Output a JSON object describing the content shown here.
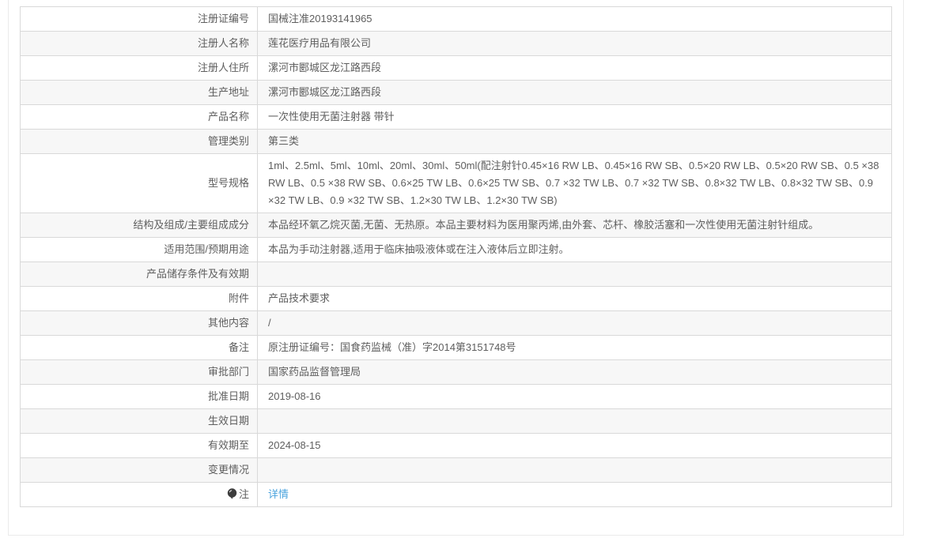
{
  "colors": {
    "link": "#4ba4de",
    "text": "#5e5e5e",
    "row_alt_bg": "#f7f7f7",
    "border": "#d9d9d9"
  },
  "table": {
    "rows": [
      {
        "label": "注册证编号",
        "value": "国械注准20193141965"
      },
      {
        "label": "注册人名称",
        "value": "莲花医疗用品有限公司"
      },
      {
        "label": "注册人住所",
        "value": "漯河市郾城区龙江路西段"
      },
      {
        "label": "生产地址",
        "value": "漯河市郾城区龙江路西段"
      },
      {
        "label": "产品名称",
        "value": "一次性使用无菌注射器 带针"
      },
      {
        "label": "管理类别",
        "value": "第三类"
      },
      {
        "label": "型号规格",
        "value": "1ml、2.5ml、5ml、10ml、20ml、30ml、50ml(配注射针0.45×16 RW LB、0.45×16 RW SB、0.5×20 RW LB、0.5×20 RW SB、0.5 ×38 RW LB、0.5 ×38 RW SB、0.6×25 TW LB、0.6×25 TW SB、0.7 ×32 TW LB、0.7 ×32 TW SB、0.8×32 TW LB、0.8×32 TW SB、0.9 ×32 TW LB、0.9 ×32 TW SB、1.2×30 TW LB、1.2×30 TW SB)"
      },
      {
        "label": "结构及组成/主要组成成分",
        "value": "本品经环氧乙烷灭菌,无菌、无热原。本品主要材料为医用聚丙烯,由外套、芯杆、橡胶活塞和一次性使用无菌注射针组成。"
      },
      {
        "label": "适用范围/预期用途",
        "value": "本品为手动注射器,适用于临床抽吸液体或在注入液体后立即注射。"
      },
      {
        "label": "产品储存条件及有效期",
        "value": ""
      },
      {
        "label": "附件",
        "value": "产品技术要求"
      },
      {
        "label": "其他内容",
        "value": "/"
      },
      {
        "label": "备注",
        "value": "原注册证编号：国食药监械（准）字2014第3151748号"
      },
      {
        "label": "审批部门",
        "value": "国家药品监督管理局"
      },
      {
        "label": "批准日期",
        "value": "2019-08-16"
      },
      {
        "label": "生效日期",
        "value": ""
      },
      {
        "label": "有效期至",
        "value": "2024-08-15"
      },
      {
        "label": "变更情况",
        "value": ""
      },
      {
        "label": "注",
        "value": "详情",
        "icon": "note-balloon-icon",
        "link": true
      }
    ]
  }
}
